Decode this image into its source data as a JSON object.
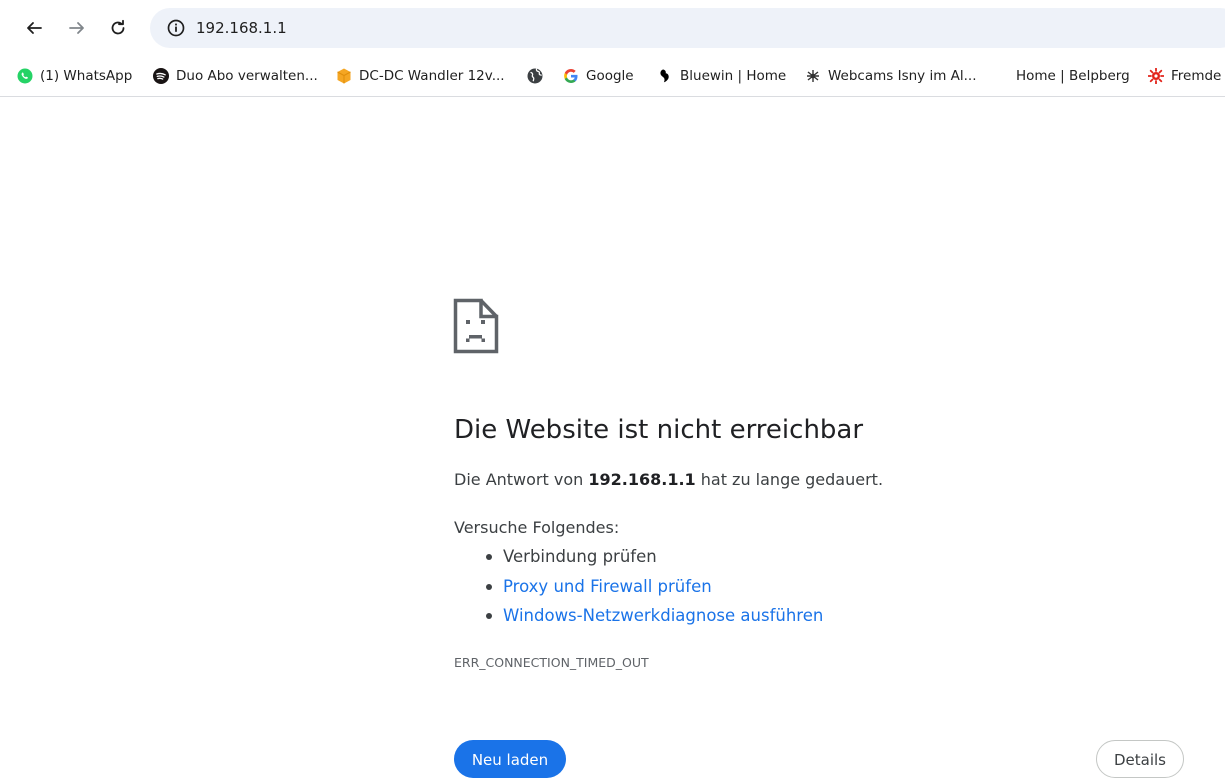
{
  "browser": {
    "url": "192.168.1.1",
    "bookmarks": [
      {
        "label": "(1) WhatsApp",
        "icon": "whatsapp-icon",
        "color": "#25d366"
      },
      {
        "label": "Duo Abo verwalten...",
        "icon": "spotify-icon",
        "color": "#191414"
      },
      {
        "label": "DC-DC Wandler 12v...",
        "icon": "package-icon",
        "color": "#f5a623"
      },
      {
        "label": "",
        "icon": "globe-icon",
        "color": "#3c4043"
      },
      {
        "label": "Google",
        "icon": "google-icon",
        "color": "#4285f4"
      },
      {
        "label": "Bluewin | Home",
        "icon": "bluewin-icon",
        "color": "#000000"
      },
      {
        "label": "Webcams Isny im Al...",
        "icon": "crest-icon",
        "color": "#333333"
      },
      {
        "label": "Home | Belpberg",
        "icon": "",
        "color": ""
      },
      {
        "label": "Fremde",
        "icon": "sun-icon",
        "color": "#e2231a"
      }
    ]
  },
  "error": {
    "title": "Die Website ist nicht erreichbar",
    "desc_prefix": "Die Antwort von ",
    "desc_host": "192.168.1.1",
    "desc_suffix": " hat zu lange gedauert.",
    "suggestions_heading": "Versuche Folgendes:",
    "suggestions": [
      {
        "text": "Verbindung prüfen",
        "link": false
      },
      {
        "text": "Proxy und Firewall prüfen",
        "link": true
      },
      {
        "text": "Windows-Netzwerkdiagnose ausführen",
        "link": true
      }
    ],
    "code": "ERR_CONNECTION_TIMED_OUT"
  },
  "buttons": {
    "reload": "Neu laden",
    "details": "Details"
  },
  "colors": {
    "link": "#1a73e8",
    "primary_button": "#1a73e8",
    "omnibox_bg": "#eef2f9"
  }
}
